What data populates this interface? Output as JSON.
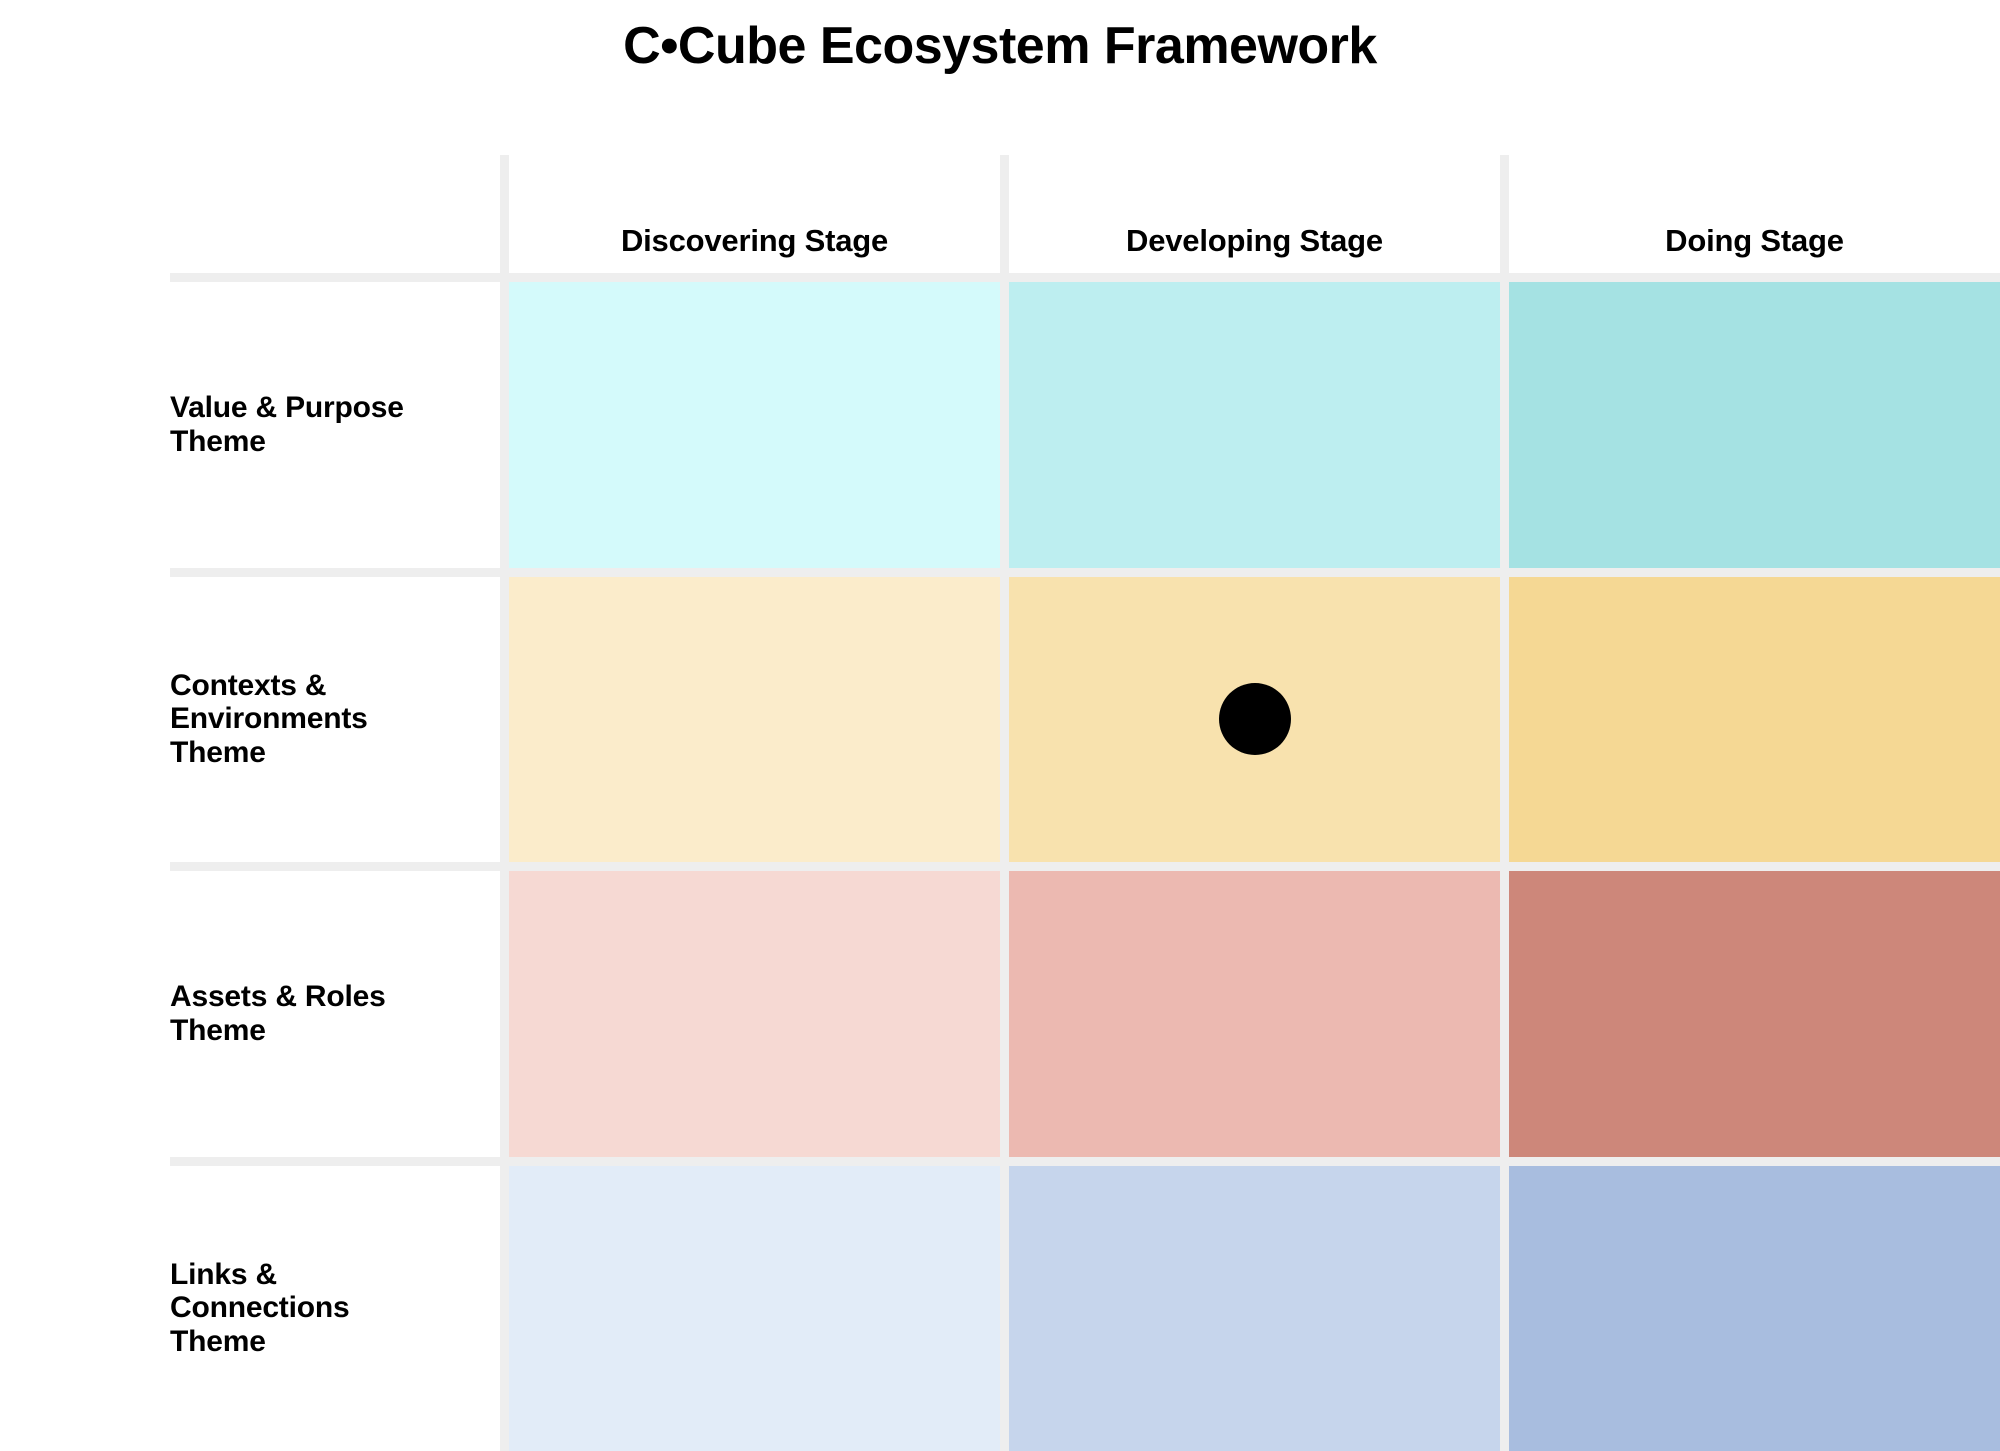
{
  "title": "C•Cube Ecosystem Framework",
  "columns": [
    {
      "id": "discovering",
      "label": "Discovering Stage"
    },
    {
      "id": "developing",
      "label": "Developing Stage"
    },
    {
      "id": "doing",
      "label": "Doing Stage"
    }
  ],
  "rows": [
    {
      "id": "value-purpose",
      "label": "Value & Purpose Theme",
      "lines": [
        "Value & Purpose",
        "Theme"
      ]
    },
    {
      "id": "contexts-environments",
      "label": "Contexts & Environments Theme",
      "lines": [
        "Contexts &",
        "Environments",
        "Theme"
      ]
    },
    {
      "id": "assets-roles",
      "label": "Assets & Roles Theme",
      "lines": [
        "Assets & Roles",
        "Theme"
      ]
    },
    {
      "id": "links-connections",
      "label": "Links & Connections Theme",
      "lines": [
        "Links &",
        "Connections",
        "Theme"
      ]
    }
  ],
  "grid_background": "#eeeeee",
  "gutter_color": "#eeeeee",
  "marker": {
    "row": "contexts-environments",
    "column": "developing",
    "color": "#000000",
    "shape": "circle"
  },
  "chart_data": {
    "type": "heatmap",
    "title": "C•Cube Ecosystem Framework",
    "xlabel": "",
    "ylabel": "",
    "grid": true,
    "legend": "none",
    "categories": [
      "Discovering Stage",
      "Developing Stage",
      "Doing Stage"
    ],
    "row_categories": [
      "Value & Purpose Theme",
      "Contexts & Environments Theme",
      "Assets & Roles Theme",
      "Links & Connections Theme"
    ],
    "series": [
      {
        "name": "Value & Purpose Theme",
        "values": [
          1,
          2,
          3
        ],
        "colors": [
          "#d4fafb",
          "#bdeef0",
          "#a5e2e3"
        ]
      },
      {
        "name": "Contexts & Environments Theme",
        "values": [
          1,
          2,
          3
        ],
        "colors": [
          "#fbeccb",
          "#f8e2ae",
          "#f5d894"
        ]
      },
      {
        "name": "Assets & Roles Theme",
        "values": [
          1,
          2,
          3
        ],
        "colors": [
          "#f6d9d3",
          "#ecb9b1",
          "#cd877a"
        ]
      },
      {
        "name": "Links & Connections Theme",
        "values": [
          1,
          2,
          3
        ],
        "colors": [
          "#e2ecf8",
          "#c6d5ec",
          "#a8bddf"
        ]
      }
    ],
    "annotations": [
      {
        "type": "marker",
        "shape": "circle",
        "color": "#000000",
        "row": "Contexts & Environments Theme",
        "column": "Developing Stage"
      }
    ]
  }
}
